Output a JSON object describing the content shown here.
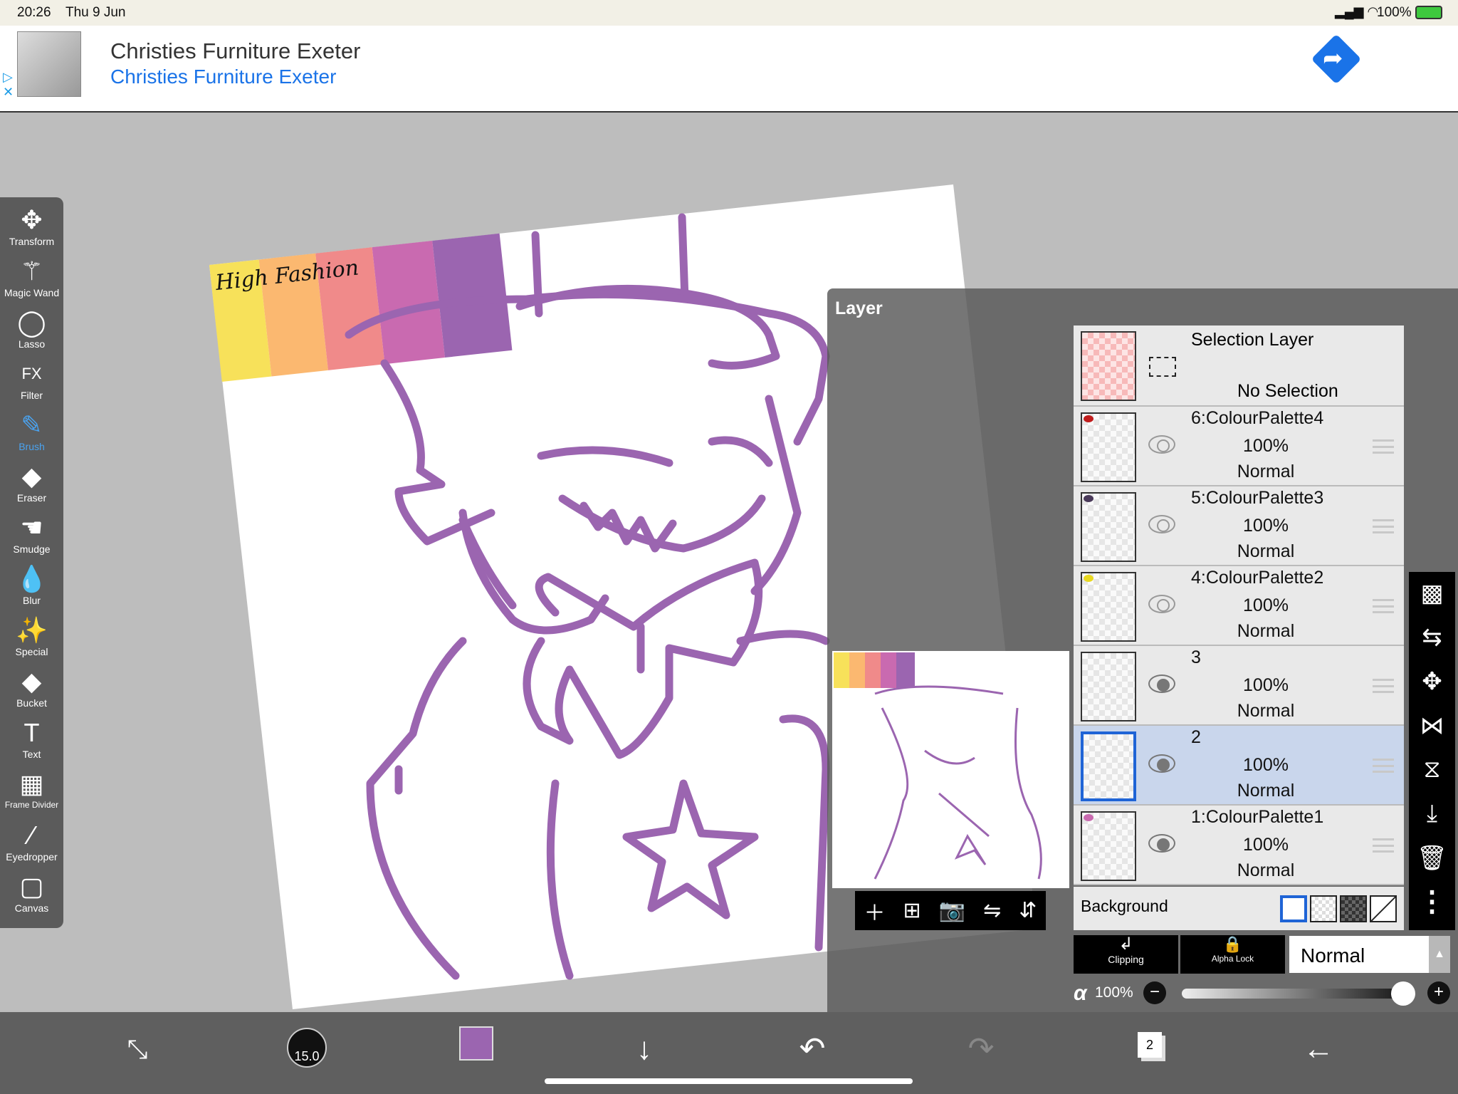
{
  "status": {
    "time": "20:26",
    "date": "Thu 9 Jun",
    "battery": "100%"
  },
  "ad": {
    "title": "Christies Furniture Exeter",
    "subtitle": "Christies Furniture Exeter",
    "accent": "#1a73e8"
  },
  "tools": [
    {
      "label": "Transform",
      "icon": "move-icon",
      "glyph": "✥"
    },
    {
      "label": "Magic Wand",
      "icon": "magic-wand-icon",
      "glyph": "⚚"
    },
    {
      "label": "Lasso",
      "icon": "lasso-icon",
      "glyph": "◯"
    },
    {
      "label": "Filter",
      "icon": "fx-icon",
      "glyph": "FX"
    },
    {
      "label": "Brush",
      "icon": "brush-icon",
      "glyph": "✎",
      "active": true
    },
    {
      "label": "Eraser",
      "icon": "eraser-icon",
      "glyph": "◆"
    },
    {
      "label": "Smudge",
      "icon": "smudge-icon",
      "glyph": "☚"
    },
    {
      "label": "Blur",
      "icon": "blur-drop-icon",
      "glyph": "💧"
    },
    {
      "label": "Special",
      "icon": "special-icon",
      "glyph": "✨"
    },
    {
      "label": "Bucket",
      "icon": "bucket-icon",
      "glyph": "◆"
    },
    {
      "label": "Text",
      "icon": "text-icon",
      "glyph": "T"
    },
    {
      "label": "Frame Divider",
      "icon": "frame-divider-icon",
      "glyph": "▦"
    },
    {
      "label": "Eyedropper",
      "icon": "eyedropper-icon",
      "glyph": "⁄"
    },
    {
      "label": "Canvas",
      "icon": "canvas-icon",
      "glyph": "▢"
    }
  ],
  "artwork": {
    "caption": "High Fashion",
    "palette": [
      "#f7e15a",
      "#fbb870",
      "#f08a8a",
      "#c96ab0",
      "#9b65b0"
    ],
    "line_color": "#9b65b0"
  },
  "layer_panel": {
    "title": "Layer",
    "selection": {
      "name": "Selection Layer",
      "status": "No Selection"
    },
    "layers": [
      {
        "name": "6:ColourPalette4",
        "opacity": "100%",
        "blend": "Normal",
        "visible": true,
        "selected": false
      },
      {
        "name": "5:ColourPalette3",
        "opacity": "100%",
        "blend": "Normal",
        "visible": true,
        "selected": false
      },
      {
        "name": "4:ColourPalette2",
        "opacity": "100%",
        "blend": "Normal",
        "visible": true,
        "selected": false
      },
      {
        "name": "3",
        "opacity": "100%",
        "blend": "Normal",
        "visible": true,
        "selected": false
      },
      {
        "name": "2",
        "opacity": "100%",
        "blend": "Normal",
        "visible": true,
        "selected": true
      },
      {
        "name": "1:ColourPalette1",
        "opacity": "100%",
        "blend": "Normal",
        "visible": true,
        "selected": false
      }
    ],
    "background_label": "Background",
    "clipping": "Clipping",
    "alpha_lock": "Alpha Lock",
    "blend_mode": "Normal",
    "alpha_symbol": "α",
    "alpha_value": "100%",
    "alpha_percent": 100
  },
  "bottom": {
    "brush_size": "15.0",
    "color": "#9b65b0",
    "layer_count": "2"
  }
}
